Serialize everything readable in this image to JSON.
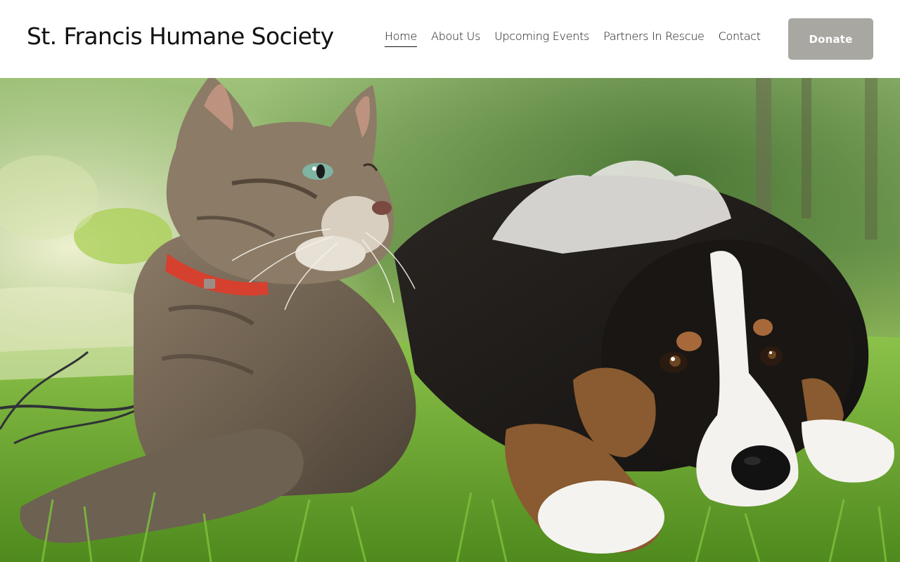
{
  "site": {
    "title": "St. Francis Humane Society"
  },
  "nav": {
    "items": [
      {
        "label": "Home",
        "active": true
      },
      {
        "label": "About Us",
        "active": false
      },
      {
        "label": "Upcoming Events",
        "active": false
      },
      {
        "label": "Partners In Rescue",
        "active": false
      },
      {
        "label": "Contact",
        "active": false
      }
    ]
  },
  "header": {
    "donate_label": "Donate"
  },
  "colors": {
    "background": "#ffffff",
    "text": "#111111",
    "donate_button": "#a8a7a1",
    "donate_text": "#ffffff"
  },
  "hero": {
    "image_icon": "cat-and-dog-photo"
  }
}
